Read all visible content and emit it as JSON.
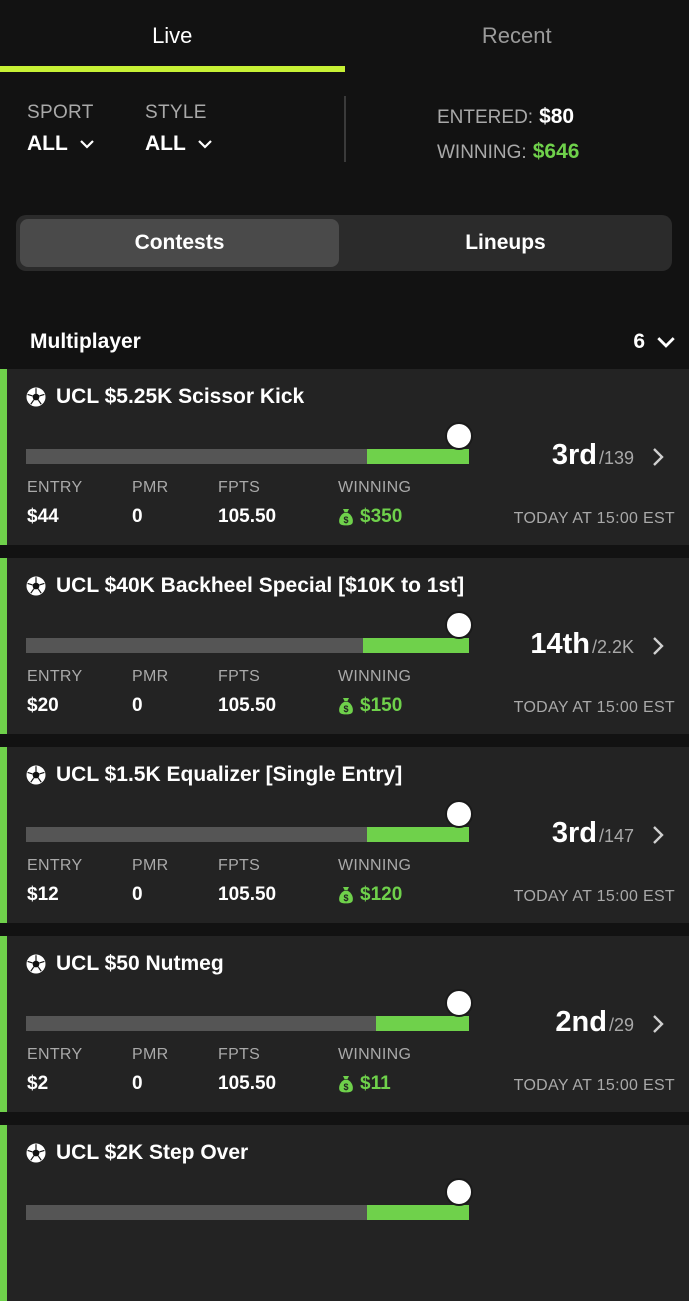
{
  "tabs": [
    {
      "label": "Live",
      "active": true
    },
    {
      "label": "Recent",
      "active": false
    }
  ],
  "filters": {
    "sport": {
      "label": "SPORT",
      "value": "ALL"
    },
    "style": {
      "label": "STYLE",
      "value": "ALL"
    }
  },
  "summary": {
    "entered_label": "ENTERED:",
    "entered_value": "$80",
    "winning_label": "WINNING:",
    "winning_value": "$646"
  },
  "segment": {
    "contests": "Contests",
    "lineups": "Lineups",
    "selected": "Contests"
  },
  "section": {
    "title": "Multiplayer",
    "count": "6"
  },
  "stat_labels": {
    "entry": "ENTRY",
    "pmr": "PMR",
    "fpts": "FPTS",
    "winning": "WINNING"
  },
  "contests": [
    {
      "title": "UCL $5.25K Scissor Kick",
      "rank": "3rd",
      "total": "/139",
      "entry": "$44",
      "pmr": "0",
      "fpts": "105.50",
      "winning": "$350",
      "date": "TODAY AT 15:00 EST",
      "progress": 0.23
    },
    {
      "title": "UCL $40K Backheel Special [$10K to 1st]",
      "rank": "14th",
      "total": "/2.2K",
      "entry": "$20",
      "pmr": "0",
      "fpts": "105.50",
      "winning": "$150",
      "date": "TODAY AT 15:00 EST",
      "progress": 0.24
    },
    {
      "title": "UCL $1.5K Equalizer [Single Entry]",
      "rank": "3rd",
      "total": "/147",
      "entry": "$12",
      "pmr": "0",
      "fpts": "105.50",
      "winning": "$120",
      "date": "TODAY AT 15:00 EST",
      "progress": 0.23
    },
    {
      "title": "UCL $50 Nutmeg",
      "rank": "2nd",
      "total": "/29",
      "entry": "$2",
      "pmr": "0",
      "fpts": "105.50",
      "winning": "$11",
      "date": "TODAY AT 15:00 EST",
      "progress": 0.21
    },
    {
      "title": "UCL $2K Step Over",
      "progress": 0.23
    }
  ],
  "colors": {
    "accent_tab": "#c7f135",
    "green": "#6fd14b",
    "background": "#121212",
    "card": "#232323"
  },
  "icons": {
    "chevron_down": "chevron-down-icon",
    "chevron_right": "chevron-right-icon",
    "soccer_ball": "soccer-ball-icon",
    "money_bag": "money-bag-icon"
  }
}
